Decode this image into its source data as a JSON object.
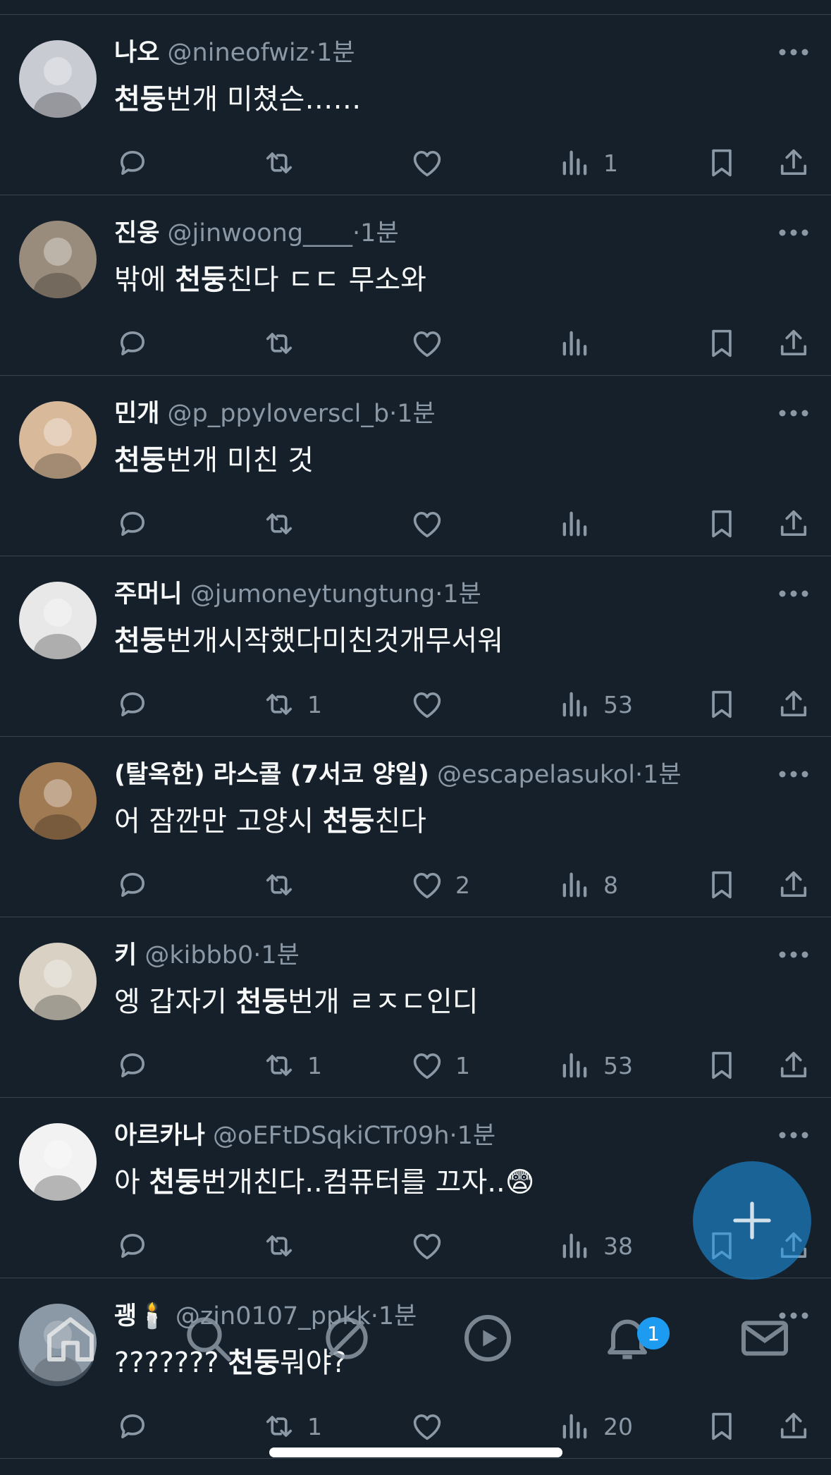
{
  "colors": {
    "background": "#15202b",
    "text": "#f7f9f9",
    "secondary": "#8b98a5",
    "accent": "#1d9bf0",
    "divider": "#38444d"
  },
  "separator": "·",
  "tweets": [
    {
      "name": "나오",
      "handle": "@nineofwiz",
      "time": "1분",
      "text_before": "",
      "bold": "천둥",
      "text_after": "번개 미쳤슨……",
      "replies": "",
      "retweets": "",
      "likes": "",
      "views": "1",
      "avatar_color": "#c9cbd3"
    },
    {
      "name": "진웅",
      "handle": "@jinwoong____",
      "time": "1분",
      "text_before": "밖에 ",
      "bold": "천둥",
      "text_after": "친다 ㄷㄷ 무소와",
      "replies": "",
      "retweets": "",
      "likes": "",
      "views": "",
      "avatar_color": "#9a8c7c"
    },
    {
      "name": "민개",
      "handle": "@p_ppyloverscl_b",
      "time": "1분",
      "text_before": "",
      "bold": "천둥",
      "text_after": "번개 미친 것",
      "replies": "",
      "retweets": "",
      "likes": "",
      "views": "",
      "avatar_color": "#d8b99a"
    },
    {
      "name": "주머니",
      "handle": "@jumoneytungtung",
      "time": "1분",
      "text_before": "",
      "bold": "천둥",
      "text_after": "번개시작했다미친것개무서워",
      "replies": "",
      "retweets": "1",
      "likes": "",
      "views": "53",
      "avatar_color": "#e8e8e8"
    },
    {
      "name": "(탈옥한) 라스콜 (7서코 양일)",
      "handle": "@escapelasukol",
      "time": "1분",
      "text_before": "어 잠깐만 고양시 ",
      "bold": "천둥",
      "text_after": "친다",
      "replies": "",
      "retweets": "",
      "likes": "2",
      "views": "8",
      "avatar_color": "#a07a52"
    },
    {
      "name": "키",
      "handle": "@kibbb0",
      "time": "1분",
      "text_before": "엥 갑자기 ",
      "bold": "천둥",
      "text_after": "번개 ㄹㅈㄷ인디",
      "replies": "",
      "retweets": "1",
      "likes": "1",
      "views": "53",
      "avatar_color": "#d9d2c4"
    },
    {
      "name": "아르카나",
      "handle": "@oEFtDSqkiCTr09h",
      "time": "1분",
      "text_before": "아 ",
      "bold": "천둥",
      "text_after": "번개친다..컴퓨터를 끄자..😨",
      "replies": "",
      "retweets": "",
      "likes": "",
      "views": "38",
      "avatar_color": "#f2f2f2"
    },
    {
      "name": "괭🕯️",
      "handle": "@zin0107_ppkk",
      "time": "1분",
      "text_before": "??????? ",
      "bold": "천둥",
      "text_after": "뭐야?",
      "replies": "",
      "retweets": "1",
      "likes": "",
      "views": "20",
      "avatar_color": "#8b98a5"
    }
  ],
  "fab": {
    "icon": "plus-icon"
  },
  "tabbar": {
    "items": [
      "home-icon",
      "search-icon",
      "spaces-icon",
      "video-icon",
      "notifications-icon",
      "messages-icon"
    ],
    "notification_count": "1"
  }
}
